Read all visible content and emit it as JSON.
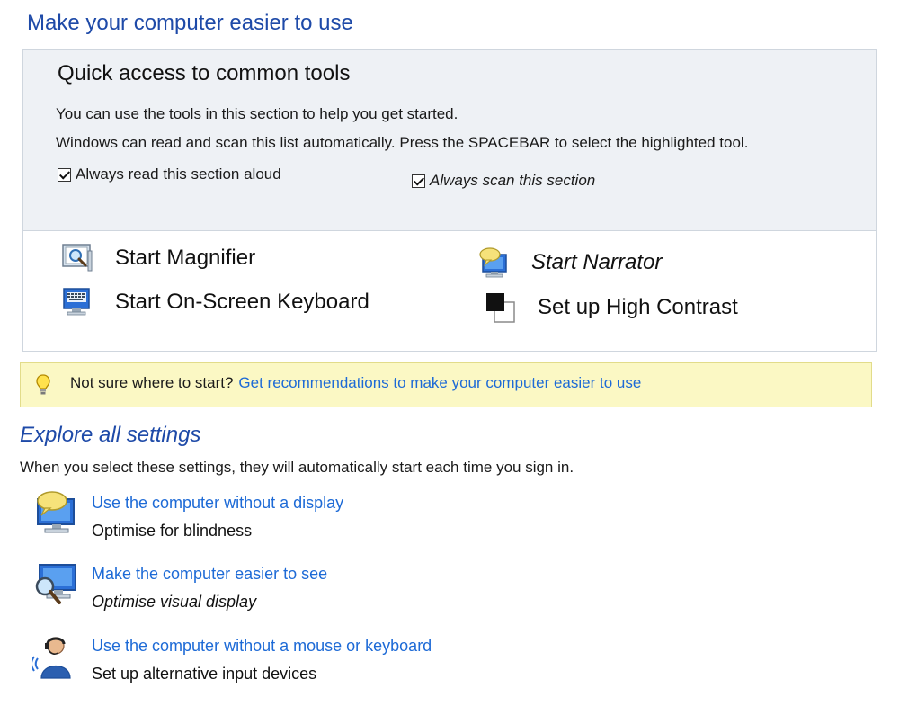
{
  "page": {
    "title": "Make your computer easier to use"
  },
  "quick_access": {
    "heading": "Quick access to common tools",
    "description_1": "You can use the tools in this section to help you get started.",
    "description_2": "Windows can read and scan this list automatically.  Press the SPACEBAR to select the highlighted tool.",
    "checkbox_read_aloud": {
      "label": "Always read this section aloud",
      "checked": true
    },
    "checkbox_scan": {
      "label": "Always scan this section",
      "checked": true
    },
    "tools": [
      {
        "label": "Start Magnifier",
        "icon": "magnifier-icon"
      },
      {
        "label": "Start On-Screen Keyboard",
        "icon": "keyboard-icon"
      },
      {
        "label": "Start Narrator",
        "icon": "narrator-icon"
      },
      {
        "label": "Set up High Contrast",
        "icon": "high-contrast-icon"
      }
    ]
  },
  "tip": {
    "icon": "lightbulb-icon",
    "prefix": "Not sure where to start?",
    "link": "Get recommendations to make your computer easier to use"
  },
  "explore": {
    "title": "Explore all settings",
    "description": "When you select these settings, they will automatically start each time you sign in.",
    "settings": [
      {
        "link": "Use the computer without a display",
        "subtitle": "Optimise for blindness",
        "icon": "monitor-speech-icon"
      },
      {
        "link": "Make the computer easier to see",
        "subtitle": "Optimise visual display",
        "icon": "monitor-magnifier-icon"
      },
      {
        "link": "Use the computer without a mouse or keyboard",
        "subtitle": "Set up alternative input devices",
        "icon": "headset-user-icon"
      }
    ]
  },
  "colors": {
    "title_blue": "#1e4aa8",
    "link_blue": "#1d6ad6",
    "panel_gray": "#eef1f5",
    "tip_yellow": "#fbf8c4"
  }
}
